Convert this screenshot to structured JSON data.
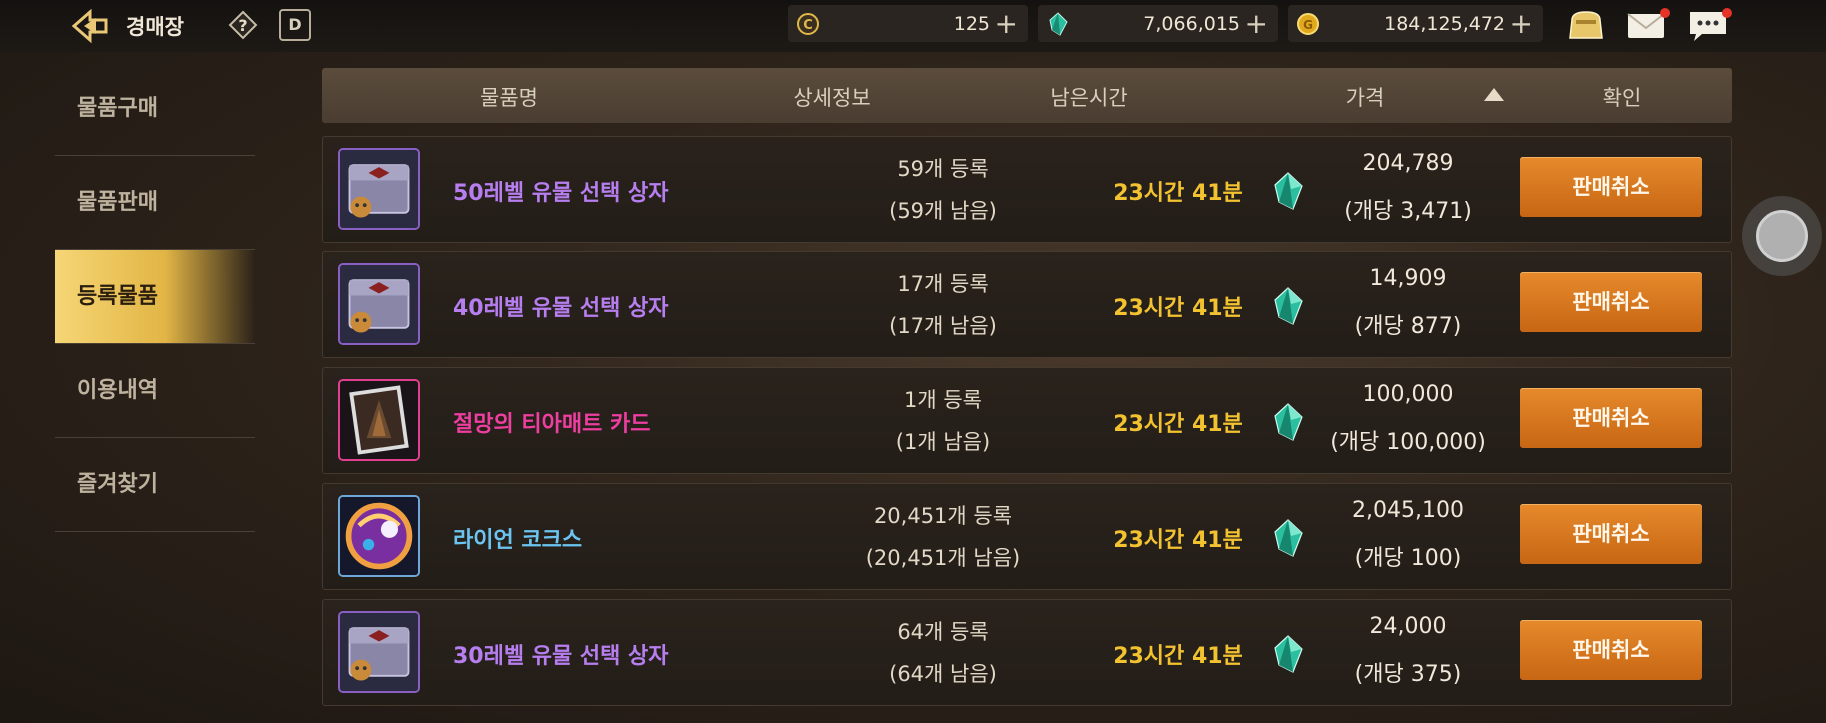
{
  "header": {
    "title": "경매장",
    "calendar_label": "D",
    "currencies": [
      {
        "icon": "c-coin-icon",
        "value": "125"
      },
      {
        "icon": "crystal-gem-icon",
        "value": "7,066,015"
      },
      {
        "icon": "gold-coin-icon",
        "value": "184,125,472"
      }
    ]
  },
  "sidebar": {
    "items": [
      {
        "label": "물품구매"
      },
      {
        "label": "물품판매"
      },
      {
        "label": "등록물품"
      },
      {
        "label": "이용내역"
      },
      {
        "label": "즐겨찾기"
      }
    ],
    "active_index": 2
  },
  "table": {
    "columns": [
      "물품명",
      "상세정보",
      "남은시간",
      "가격",
      "확인"
    ],
    "sort_column": "남은시간",
    "rows": [
      {
        "name": "50레벨 유물 선택 상자",
        "name_color": "#b77ef0",
        "detail1": "59개 등록",
        "detail2": "(59개 남음)",
        "time": "23시간 41분",
        "price": "204,789",
        "unit": "(개당 3,471)",
        "action": "판매취소",
        "icon": "relic-box-icon"
      },
      {
        "name": "40레벨 유물 선택 상자",
        "name_color": "#b77ef0",
        "detail1": "17개 등록",
        "detail2": "(17개 남음)",
        "time": "23시간 41분",
        "price": "14,909",
        "unit": "(개당 877)",
        "action": "판매취소",
        "icon": "relic-box-icon"
      },
      {
        "name": "절망의 티아매트 카드",
        "name_color": "#ee3fa0",
        "detail1": "1개 등록",
        "detail2": "(1개 남음)",
        "time": "23시간 41분",
        "price": "100,000",
        "unit": "(개당 100,000)",
        "action": "판매취소",
        "icon": "card-icon"
      },
      {
        "name": "라이언 코크스",
        "name_color": "#6cc4f0",
        "detail1": "20,451개 등록",
        "detail2": "(20,451개 남음)",
        "time": "23시간 41분",
        "price": "2,045,100",
        "unit": "(개당 100)",
        "action": "판매취소",
        "icon": "orb-icon"
      },
      {
        "name": "30레벨 유물 선택 상자",
        "name_color": "#b77ef0",
        "detail1": "64개 등록",
        "detail2": "(64개 남음)",
        "time": "23시간 41분",
        "price": "24,000",
        "unit": "(개당 375)",
        "action": "판매취소",
        "icon": "relic-box-icon"
      }
    ]
  }
}
